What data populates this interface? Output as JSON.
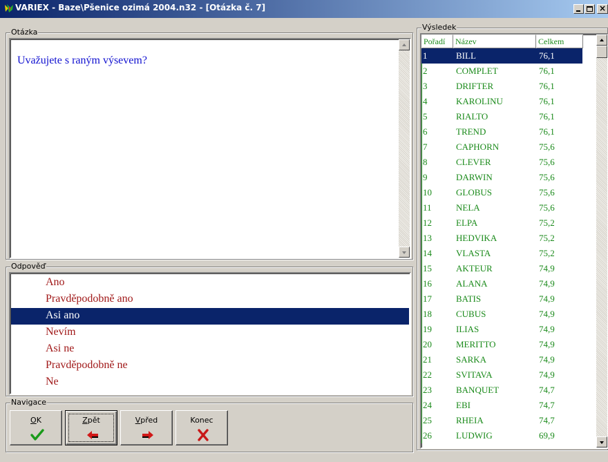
{
  "window": {
    "title": "VARIEX - Baze\\Pšenice ozimá 2004.n32 - [Otázka č. 7]",
    "controls": {
      "minimize": "_",
      "maximize": "□",
      "close": "×"
    }
  },
  "question": {
    "legend": "Otázka",
    "text": "Uvažujete s raným výsevem?"
  },
  "answers": {
    "legend": "Odpověď",
    "items": [
      "Ano",
      "Pravděpodobně ano",
      "Asi ano",
      "Nevím",
      "Asi ne",
      "Pravděpodobně ne",
      "Ne"
    ],
    "selected_index": 2
  },
  "navigation": {
    "legend": "Navigace",
    "buttons": [
      {
        "label": "OK",
        "accel": "O",
        "icon": "check-icon"
      },
      {
        "label": "Zpět",
        "accel": "Z",
        "icon": "arrow-left-icon"
      },
      {
        "label": "Vpřed",
        "accel": "V",
        "icon": "arrow-right-icon"
      },
      {
        "label": "Konec",
        "accel": "",
        "icon": "cross-icon"
      }
    ]
  },
  "result": {
    "legend": "Výsledek",
    "columns": [
      "Pořadí",
      "Název",
      "Celkem"
    ],
    "selected_index": 0,
    "rows": [
      [
        "1",
        "BILL",
        "76,1"
      ],
      [
        "2",
        "COMPLET",
        "76,1"
      ],
      [
        "3",
        "DRIFTER",
        "76,1"
      ],
      [
        "4",
        "KAROLINU",
        "76,1"
      ],
      [
        "5",
        "RIALTO",
        "76,1"
      ],
      [
        "6",
        "TREND",
        "76,1"
      ],
      [
        "7",
        "CAPHORN",
        "75,6"
      ],
      [
        "8",
        "CLEVER",
        "75,6"
      ],
      [
        "9",
        "DARWIN",
        "75,6"
      ],
      [
        "10",
        "GLOBUS",
        "75,6"
      ],
      [
        "11",
        "NELA",
        "75,6"
      ],
      [
        "12",
        "ELPA",
        "75,2"
      ],
      [
        "13",
        "HEDVIKA",
        "75,2"
      ],
      [
        "14",
        "VLASTA",
        "75,2"
      ],
      [
        "15",
        "AKTEUR",
        "74,9"
      ],
      [
        "16",
        "ALANA",
        "74,9"
      ],
      [
        "17",
        "BATIS",
        "74,9"
      ],
      [
        "18",
        "CUBUS",
        "74,9"
      ],
      [
        "19",
        "ILIAS",
        "74,9"
      ],
      [
        "20",
        "MERITTO",
        "74,9"
      ],
      [
        "21",
        "SARKA",
        "74,9"
      ],
      [
        "22",
        "SVITAVA",
        "74,9"
      ],
      [
        "23",
        "BANQUET",
        "74,7"
      ],
      [
        "24",
        "EBI",
        "74,7"
      ],
      [
        "25",
        "RHEIA",
        "74,7"
      ],
      [
        "26",
        "LUDWIG",
        "69,9"
      ]
    ]
  },
  "colors": {
    "titlebar_start": "#0a246a",
    "titlebar_end": "#a6caf0",
    "selection": "#0a246a",
    "question_text": "#1010d0",
    "answer_text": "#a01818",
    "result_text": "#1a8a1a"
  }
}
